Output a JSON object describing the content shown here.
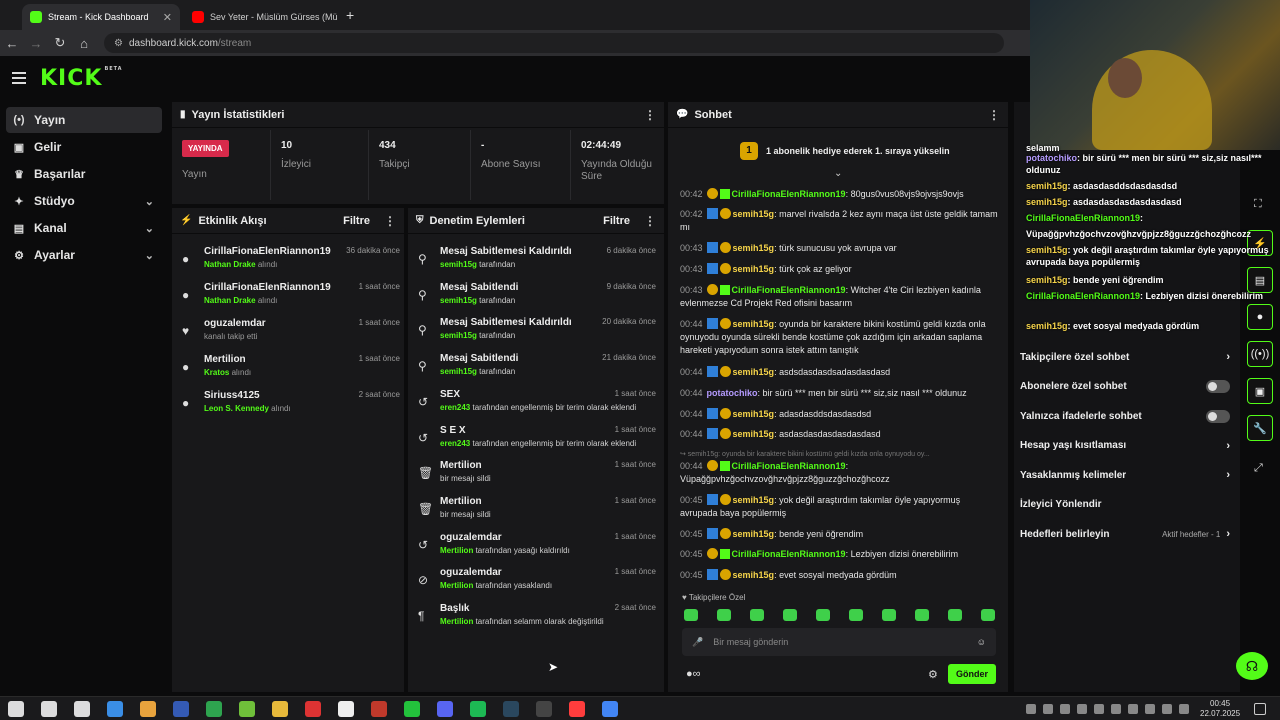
{
  "browser": {
    "tabs": [
      {
        "label": "Stream - Kick Dashboard",
        "active": true,
        "color": "#53fc18"
      },
      {
        "label": "Sev Yeter - Müslüm Gürses (Mü",
        "active": false,
        "color": "#ff0000"
      }
    ],
    "new_tab": "+",
    "url_host": "dashboard.kick.com",
    "url_path": "/stream"
  },
  "brand": {
    "logo": "KICK",
    "beta": "BETA",
    "accent": "#53fc18"
  },
  "sidebar": {
    "items": [
      {
        "label": "Yayın",
        "icon": "broadcast-icon",
        "glyph": "(•)",
        "active": true,
        "chev": ""
      },
      {
        "label": "Gelir",
        "icon": "money-icon",
        "glyph": "▣",
        "chev": ""
      },
      {
        "label": "Başarılar",
        "icon": "trophy-icon",
        "glyph": "♛",
        "chev": ""
      },
      {
        "label": "Stüdyo",
        "icon": "studio-icon",
        "glyph": "✦",
        "chev": "⌄"
      },
      {
        "label": "Kanal",
        "icon": "channel-icon",
        "glyph": "▤",
        "chev": "⌄"
      },
      {
        "label": "Ayarlar",
        "icon": "settings-icon",
        "glyph": "⚙",
        "chev": "⌄"
      }
    ]
  },
  "stats": {
    "title": "Yayın İstatistikleri",
    "live_badge": "YAYINDA",
    "live_label": "Yayın",
    "viewers_value": "10",
    "viewers_label": "İzleyici",
    "followers_value": "434",
    "followers_label": "Takipçi",
    "subs_value": "-",
    "subs_label": "Abone Sayısı",
    "duration_value": "02:44:49",
    "duration_label": "Yayında Olduğu Süre"
  },
  "activity": {
    "title": "Etkinlik Akışı",
    "filter": "Filtre",
    "items": [
      {
        "name": "CirillaFionaElenRiannon19",
        "who": "Nathan Drake",
        "suffix": "alındı",
        "time": "36 dakika önce",
        "glyph": "●"
      },
      {
        "name": "CirillaFionaElenRiannon19",
        "who": "Nathan Drake",
        "suffix": "alındı",
        "time": "1 saat önce",
        "glyph": "●"
      },
      {
        "name": "oguzalemdar",
        "who": "",
        "suffix": "kanalı takip etti",
        "time": "1 saat önce",
        "glyph": "♥"
      },
      {
        "name": "Mertilion",
        "who": "Kratos",
        "suffix": "alındı",
        "time": "1 saat önce",
        "glyph": "●"
      },
      {
        "name": "Siriuss4125",
        "who": "Leon S. Kennedy",
        "suffix": "alındı",
        "time": "2 saat önce",
        "glyph": "●"
      }
    ]
  },
  "moderation": {
    "title": "Denetim Eylemleri",
    "filter": "Filtre",
    "items": [
      {
        "title": "Mesaj Sabitlemesi Kaldırıldı",
        "who": "semih15g",
        "rest": "tarafından",
        "time": "6 dakika önce",
        "glyph": "⚲"
      },
      {
        "title": "Mesaj Sabitlendi",
        "who": "semih15g",
        "rest": "tarafından",
        "time": "9 dakika önce",
        "glyph": "⚲"
      },
      {
        "title": "Mesaj Sabitlemesi Kaldırıldı",
        "who": "semih15g",
        "rest": "tarafından",
        "time": "20 dakika önce",
        "glyph": "⚲"
      },
      {
        "title": "Mesaj Sabitlendi",
        "who": "semih15g",
        "rest": "tarafından",
        "time": "21 dakika önce",
        "glyph": "⚲"
      },
      {
        "title": "SEX",
        "who": "eren243",
        "rest": "tarafından engellenmiş bir terim olarak eklendi",
        "time": "1 saat önce",
        "glyph": "↺"
      },
      {
        "title": "S E X",
        "who": "eren243",
        "rest": "tarafından engellenmiş bir terim olarak eklendi",
        "time": "1 saat önce",
        "glyph": "↺"
      },
      {
        "title": "Mertilion",
        "who": "",
        "rest": "bir mesajı sildi",
        "time": "1 saat önce",
        "glyph": "🗑"
      },
      {
        "title": "Mertilion",
        "who": "",
        "rest": "bir mesajı sildi",
        "time": "1 saat önce",
        "glyph": "🗑"
      },
      {
        "title": "oguzalemdar",
        "who": "Mertilion",
        "rest": "tarafından yasağı kaldırıldı",
        "time": "1 saat önce",
        "glyph": "↺"
      },
      {
        "title": "oguzalemdar",
        "who": "Mertilion",
        "rest": "tarafından yasaklandı",
        "time": "1 saat önce",
        "glyph": "⊘"
      },
      {
        "title": "Başlık",
        "who": "Mertilion",
        "rest": "tarafından selamm olarak değiştirildi",
        "time": "2 saat önce",
        "glyph": "¶"
      }
    ]
  },
  "chat": {
    "title": "Sohbet",
    "goal": "1 abonelik hediye ederek 1. sıraya yükselin",
    "messages": [
      {
        "time": "00:42",
        "user": "CirillaFionaElenRiannon19",
        "cls": "u-g",
        "badges": "ygr",
        "text": "80gus0vus08vjs9ojvsjs9ovjs"
      },
      {
        "time": "00:42",
        "user": "semih15g",
        "cls": "u-y",
        "badges": "sy",
        "text": "marvel rivalsda 2 kez aynı maça üst üste geldik tamam mı"
      },
      {
        "time": "00:43",
        "user": "semih15g",
        "cls": "u-y",
        "badges": "sy",
        "text": "türk sunucusu yok avrupa var"
      },
      {
        "time": "00:43",
        "user": "semih15g",
        "cls": "u-y",
        "badges": "sy",
        "text": "türk çok az geliyor"
      },
      {
        "time": "00:43",
        "user": "CirillaFionaElenRiannon19",
        "cls": "u-g",
        "badges": "ygr",
        "text": "Witcher 4'te Ciri lezbiyen kadınla evlenmezse Cd Projekt Red ofisini basarım"
      },
      {
        "time": "00:44",
        "user": "semih15g",
        "cls": "u-y",
        "badges": "sy",
        "text": "oyunda bir karaktere bikini kostümü geldi kızda onla oynuyodu oyunda sürekli bende kostüme çok azdığım için arkadan saplama hareketi yapıyodum sonra istek attım tanıştık"
      },
      {
        "time": "00:44",
        "user": "semih15g",
        "cls": "u-y",
        "badges": "sy",
        "text": "asdsdasdasdsadasdasdasd"
      },
      {
        "time": "00:44",
        "user": "potatochiko",
        "cls": "u-p",
        "badges": "",
        "text": "bir sürü *** men bir sürü *** siz,siz nasıl *** oldunuz"
      },
      {
        "time": "00:44",
        "user": "semih15g",
        "cls": "u-y",
        "badges": "sy",
        "text": "adasdasddsdasdasdsd"
      },
      {
        "time": "00:44",
        "user": "semih15g",
        "cls": "u-y",
        "badges": "sy",
        "text": "asdasdasdasdasdasdasd"
      },
      {
        "time": "",
        "user": "",
        "cls": "",
        "badges": "",
        "text": "↪ semih15g: oyunda bir karaktere bikini kostümü geldi kızda onla oynuyodu oy..."
      },
      {
        "time": "00:44",
        "user": "CirillaFionaElenRiannon19",
        "cls": "u-g",
        "badges": "ygr",
        "text": "Vüpağğpvhzğochvzovğhzvğpjzz8ğguzzğchozğhcozz"
      },
      {
        "time": "00:45",
        "user": "semih15g",
        "cls": "u-y",
        "badges": "sy",
        "text": "yok değil araştırdım takımlar öyle yapıyormuş avrupada baya popülermiş"
      },
      {
        "time": "00:45",
        "user": "semih15g",
        "cls": "u-y",
        "badges": "sy",
        "text": "bende yeni öğrendim"
      },
      {
        "time": "00:45",
        "user": "CirillaFionaElenRiannon19",
        "cls": "u-g",
        "badges": "ygr",
        "text": "Lezbiyen dizisi önerebilirim"
      },
      {
        "time": "00:45",
        "user": "semih15g",
        "cls": "u-y",
        "badges": "sy",
        "text": "evet sosyal medyada gördüm"
      }
    ],
    "mode_label": "Takipçilere Özel",
    "input_placeholder": "Bir mesaj gönderin",
    "send_label": "Gönder"
  },
  "settings_panel": {
    "items": [
      {
        "label": "Takipçilere özel sohbet",
        "kind": "chev"
      },
      {
        "label": "Abonelere özel sohbet",
        "kind": "toggle"
      },
      {
        "label": "Yalnızca ifadelerle sohbet",
        "kind": "toggle"
      },
      {
        "label": "Hesap yaşı kısıtlaması",
        "kind": "chev"
      },
      {
        "label": "Yasaklanmış kelimeler",
        "kind": "chev"
      },
      {
        "label": "İzleyici Yönlendir",
        "kind": "none"
      },
      {
        "label": "Hedefleri belirleyin",
        "kind": "chev",
        "extra": "Aktif hedefler - 1"
      }
    ]
  },
  "overlay": {
    "lines": [
      {
        "pre": "",
        "user": "",
        "text": "selamm"
      },
      {
        "pre": "",
        "user": "potatochiko",
        "text": ": bir sürü *** men bir sürü *** siz,siz nasıl*** oldunuz"
      },
      {
        "pre": "",
        "user": "semih15g",
        "text": ": asdasdasddsdasdasdsd"
      },
      {
        "pre": "",
        "user": "semih15g",
        "text": ": asdasdasdasdasdasdasd"
      },
      {
        "pre": "",
        "user": "CirillaFionaElenRiannon19",
        "text": ":"
      },
      {
        "pre": "",
        "user": "",
        "text": "Vüpağğpvhzğochvzovğhzvğpjzz8ğguzzğchozğhcozz"
      },
      {
        "pre": "",
        "user": "semih15g",
        "text": ": yok değil araştırdım takımlar öyle yapıyormuş avrupada baya popülermiş"
      },
      {
        "pre": "",
        "user": "semih15g",
        "text": ": bende yeni öğrendim"
      },
      {
        "pre": "",
        "user": "CirillaFionaElenRiannon19",
        "text": ": Lezbiyen dizisi önerebilirim"
      },
      {
        "pre": "",
        "user": "semih15g",
        "text": ": evet sosyal medyada gördüm"
      }
    ]
  },
  "taskbar": {
    "time": "00:45",
    "date": "22.07.2025"
  }
}
